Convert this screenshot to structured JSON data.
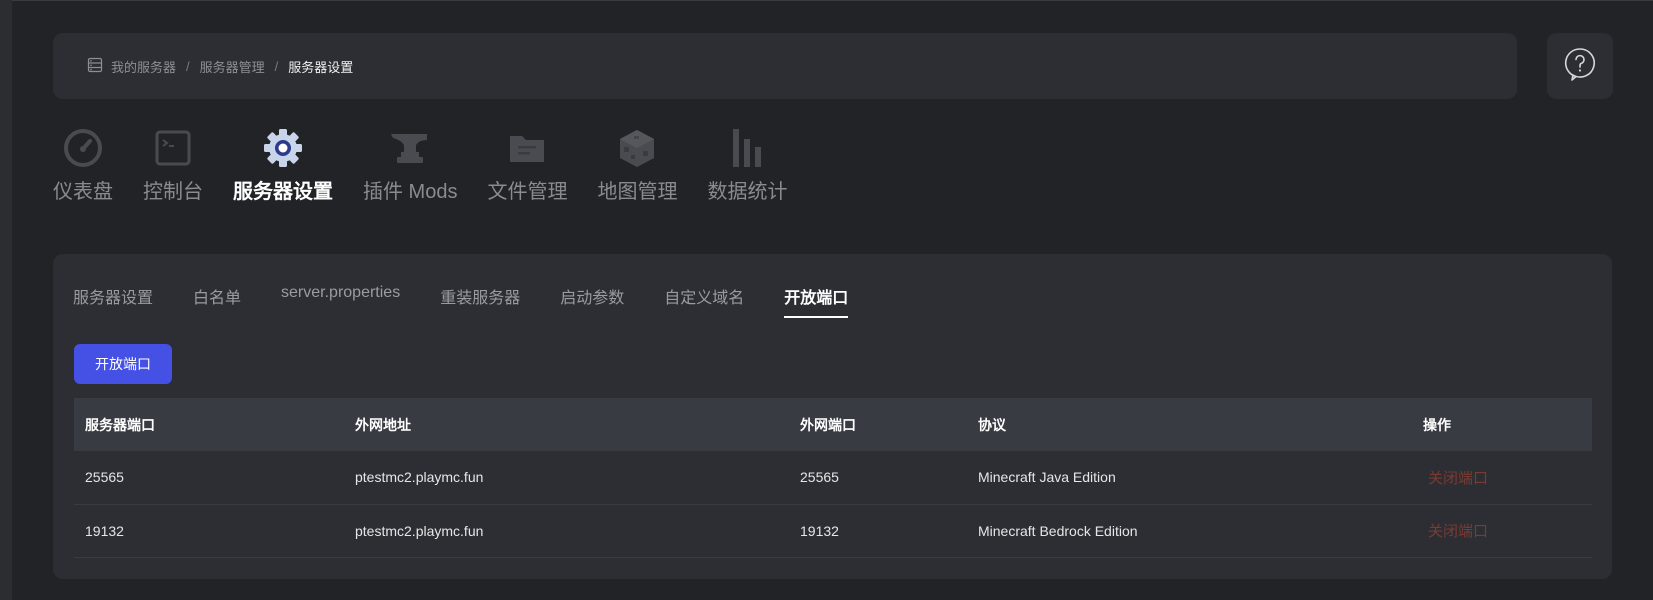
{
  "breadcrumb": {
    "items": [
      {
        "label": "我的服务器"
      },
      {
        "label": "服务器管理"
      },
      {
        "label": "服务器设置"
      }
    ],
    "separator": "/"
  },
  "help": {
    "icon": "help-question-icon"
  },
  "main_nav": {
    "items": [
      {
        "label": "仪表盘",
        "icon": "dashboard-gauge-icon",
        "active": false
      },
      {
        "label": "控制台",
        "icon": "terminal-icon",
        "active": false
      },
      {
        "label": "服务器设置",
        "icon": "gear-icon",
        "active": true
      },
      {
        "label": "插件 Mods",
        "icon": "anvil-icon",
        "active": false
      },
      {
        "label": "文件管理",
        "icon": "folder-icon",
        "active": false
      },
      {
        "label": "地图管理",
        "icon": "block-icon",
        "active": false
      },
      {
        "label": "数据统计",
        "icon": "bar-chart-icon",
        "active": false
      }
    ]
  },
  "sub_tabs": {
    "items": [
      {
        "label": "服务器设置",
        "active": false
      },
      {
        "label": "白名单",
        "active": false
      },
      {
        "label": "server.properties",
        "active": false
      },
      {
        "label": "重装服务器",
        "active": false
      },
      {
        "label": "启动参数",
        "active": false
      },
      {
        "label": "自定义域名",
        "active": false
      },
      {
        "label": "开放端口",
        "active": true
      }
    ]
  },
  "open_port_button": {
    "label": "开放端口"
  },
  "ports_table": {
    "headers": [
      "服务器端口",
      "外网地址",
      "外网端口",
      "协议",
      "操作"
    ],
    "rows": [
      {
        "server_port": "25565",
        "address": "ptestmc2.playmc.fun",
        "public_port": "25565",
        "protocol": "Minecraft Java Edition",
        "action": "关闭端口"
      },
      {
        "server_port": "19132",
        "address": "ptestmc2.playmc.fun",
        "public_port": "19132",
        "protocol": "Minecraft Bedrock Edition",
        "action": "关闭端口"
      }
    ]
  },
  "colors": {
    "background": "#222327",
    "panel": "#2d2e33",
    "accent": "#4451e4",
    "danger_link": "#7a3b32"
  }
}
